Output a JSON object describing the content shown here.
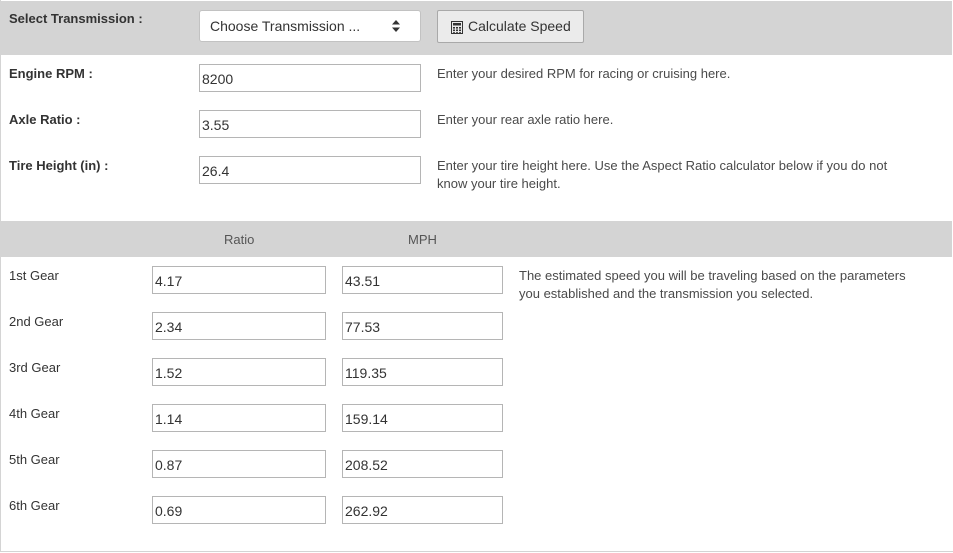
{
  "transmission": {
    "label": "Select Transmission :",
    "select_value": "Choose Transmission ...",
    "calc_button": "Calculate Speed"
  },
  "fields": {
    "rpm": {
      "label": "Engine RPM :",
      "value": "8200",
      "help": "Enter your desired RPM for racing or cruising here."
    },
    "axle": {
      "label": "Axle Ratio :",
      "value": "3.55",
      "help": "Enter your rear axle ratio here."
    },
    "tire": {
      "label": "Tire Height (in) :",
      "value": "26.4",
      "help_line1": "Enter your tire height here. Use the Aspect Ratio calculator below if you do not",
      "help_line2": "know your tire height."
    }
  },
  "table": {
    "col_ratio": "Ratio",
    "col_mph": "MPH",
    "note_line1": "The estimated speed you will be traveling based on the parameters",
    "note_line2": "you established and the transmission you selected.",
    "rows": [
      {
        "gear": "1st Gear",
        "ratio": "4.17",
        "mph": "43.51"
      },
      {
        "gear": "2nd Gear",
        "ratio": "2.34",
        "mph": "77.53"
      },
      {
        "gear": "3rd Gear",
        "ratio": "1.52",
        "mph": "119.35"
      },
      {
        "gear": "4th Gear",
        "ratio": "1.14",
        "mph": "159.14"
      },
      {
        "gear": "5th Gear",
        "ratio": "0.87",
        "mph": "208.52"
      },
      {
        "gear": "6th Gear",
        "ratio": "0.69",
        "mph": "262.92"
      }
    ]
  },
  "icons": {
    "calculator": "calculator-icon",
    "select_arrows": "select-arrows-icon"
  }
}
